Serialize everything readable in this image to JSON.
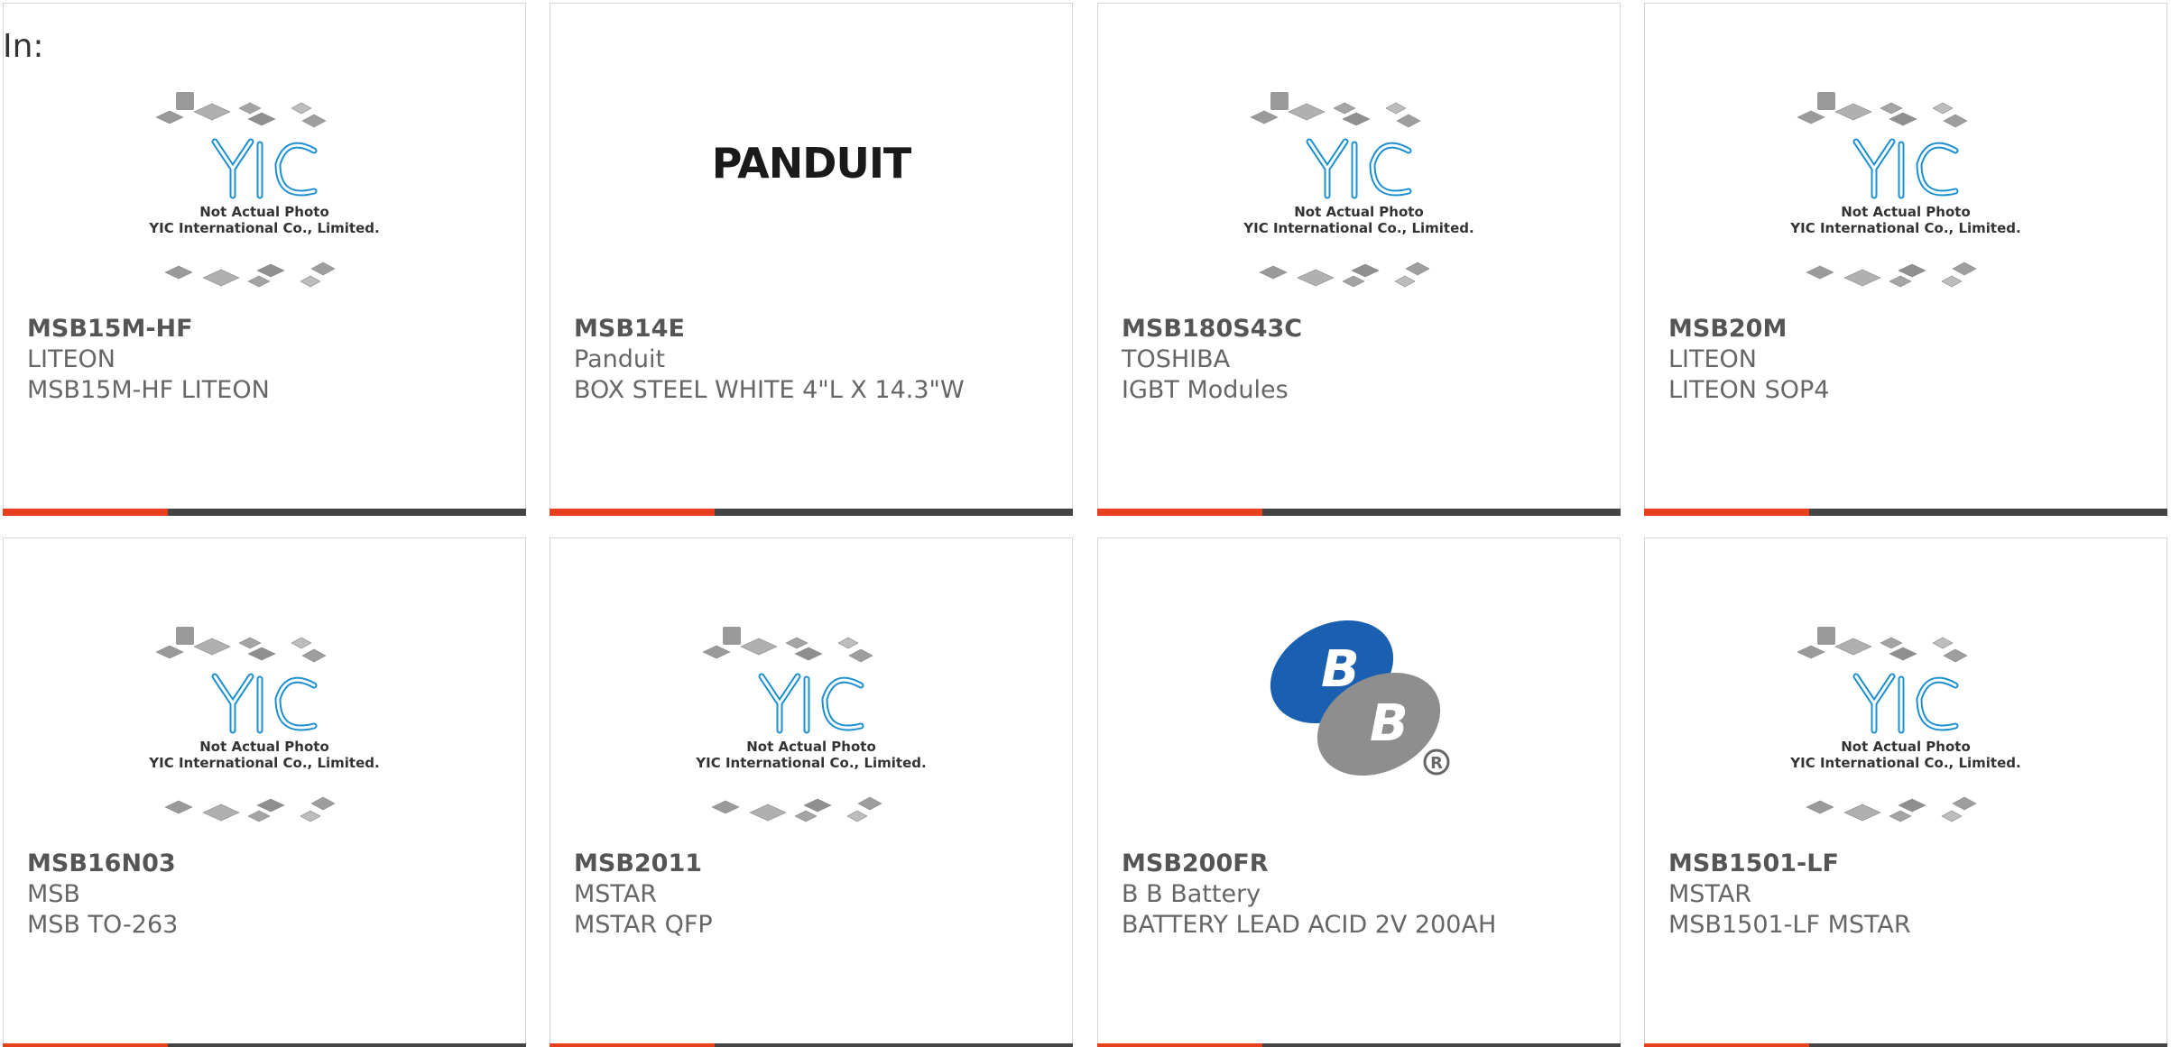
{
  "page": {
    "in_label": "In:"
  },
  "placeholder": {
    "line1": "Not Actual Photo",
    "line2": "YIC International Co., Limited."
  },
  "colors": {
    "accent": "#e8401c",
    "bar": "#444444",
    "yic_blue": "#1b8fd0",
    "chip_gray": "#a9a9a9"
  },
  "products": [
    {
      "part": "MSB15M-HF",
      "maker": "LITEON",
      "desc": "MSB15M-HF LITEON",
      "image": "yic-placeholder"
    },
    {
      "part": "MSB14E",
      "maker": "Panduit",
      "desc": "BOX STEEL WHITE 4\"L X 14.3\"W",
      "image": "panduit-logo",
      "logo_text": "PANDUIT"
    },
    {
      "part": "MSB180S43C",
      "maker": "TOSHIBA",
      "desc": "IGBT Modules",
      "image": "yic-placeholder"
    },
    {
      "part": "MSB20M",
      "maker": "LITEON",
      "desc": "LITEON SOP4",
      "image": "yic-placeholder"
    },
    {
      "part": "MSB16N03",
      "maker": "MSB",
      "desc": "MSB TO-263",
      "image": "yic-placeholder"
    },
    {
      "part": "MSB2011",
      "maker": "MSTAR",
      "desc": "MSTAR QFP",
      "image": "yic-placeholder"
    },
    {
      "part": "MSB200FR",
      "maker": "B B Battery",
      "desc": "BATTERY LEAD ACID 2V 200AH",
      "image": "bb-logo",
      "logo_text": "B"
    },
    {
      "part": "MSB1501-LF",
      "maker": "MSTAR",
      "desc": "MSB1501-LF MSTAR",
      "image": "yic-placeholder"
    }
  ]
}
